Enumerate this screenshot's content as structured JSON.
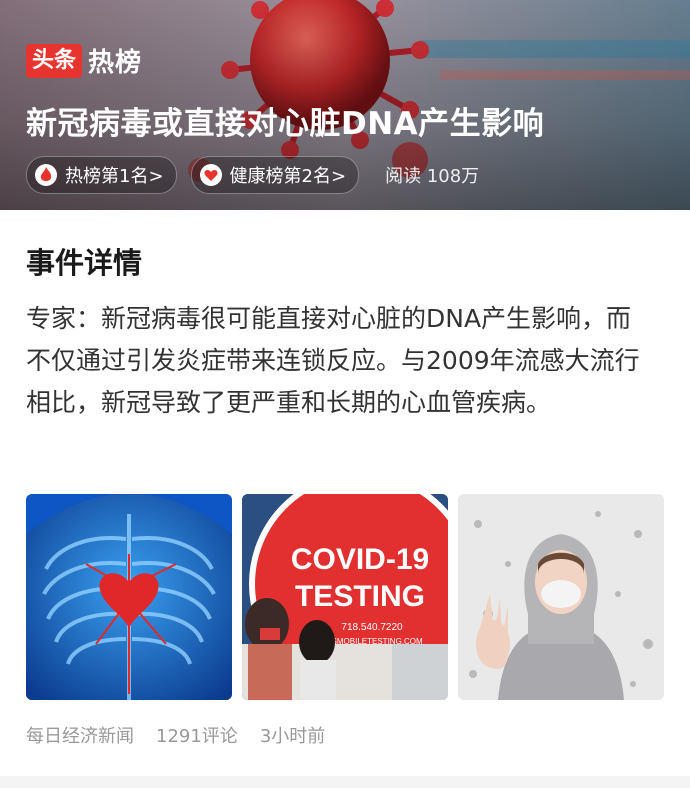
{
  "brand": {
    "logo_text": "头条",
    "suffix": "热榜"
  },
  "headline": "新冠病毒或直接对心脏DNA产生影响",
  "badges": [
    {
      "icon": "flame-icon",
      "label": "热榜第1名>"
    },
    {
      "icon": "heart-icon",
      "label": "健康榜第2名>"
    }
  ],
  "reads": "阅读 108万",
  "section_title": "事件详情",
  "summary": "专家：新冠病毒很可能直接对心脏的DNA产生影响，而不仅通过引发炎症带来连锁反应。与2009年流感大流行相比，新冠导致了更严重和长期的心血管疾病。",
  "images": [
    {
      "name": "heart-anatomy-image"
    },
    {
      "name": "covid-testing-image",
      "sign_line1": "COVID-19",
      "sign_line2": "TESTING",
      "sign_small": "718.540.7220",
      "sign_url": "ETSMOBILETESTING.COM"
    },
    {
      "name": "masked-woman-image"
    }
  ],
  "footer": {
    "source": "每日经济新闻",
    "comments": "1291评论",
    "time": "3小时前"
  },
  "colors": {
    "accent": "#e8342f",
    "muted": "#999999"
  }
}
